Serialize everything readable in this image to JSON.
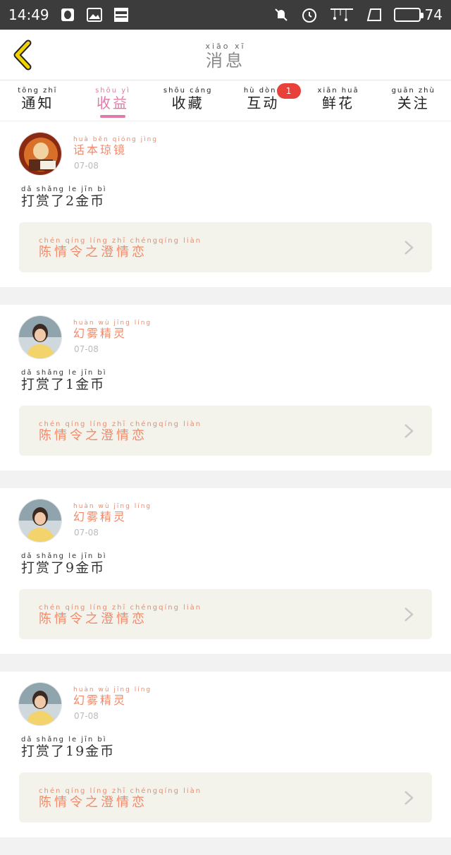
{
  "status_bar": {
    "time": "14:49",
    "battery": "74",
    "battery_level": 0.74
  },
  "header": {
    "title_pinyin": "xiāo xī",
    "title": "消息"
  },
  "tabs": [
    {
      "pinyin": "tōng zhī",
      "label": "通知"
    },
    {
      "pinyin": "shōu yì",
      "label": "收益"
    },
    {
      "pinyin": "shōu cáng",
      "label": "收藏"
    },
    {
      "pinyin": "hù dòng",
      "label": "互动",
      "badge": "1"
    },
    {
      "pinyin": "xiān huā",
      "label": "鲜花"
    },
    {
      "pinyin": "guān zhù",
      "label": "关注"
    }
  ],
  "active_tab": 1,
  "messages": [
    {
      "user_pinyin": "huà běn qióng jìng",
      "user": "话本琼镜",
      "date": "07-08",
      "tip_pinyin": "dǎ shǎng le  jīn bì",
      "tip": "打赏了2金币",
      "novel_pinyin": "chén qíng líng zhī chéngqíng liàn",
      "novel": "陈情令之澄情恋"
    },
    {
      "user_pinyin": "huàn wù jīng líng",
      "user": "幻雾精灵",
      "date": "07-08",
      "tip_pinyin": "dǎ shǎng le  jīn bì",
      "tip": "打赏了1金币",
      "novel_pinyin": "chén qíng líng zhī chéngqíng liàn",
      "novel": "陈情令之澄情恋"
    },
    {
      "user_pinyin": "huàn wù jīng líng",
      "user": "幻雾精灵",
      "date": "07-08",
      "tip_pinyin": "dǎ shǎng le  jīn bì",
      "tip": "打赏了9金币",
      "novel_pinyin": "chén qíng líng zhī chéngqíng liàn",
      "novel": "陈情令之澄情恋"
    },
    {
      "user_pinyin": "huàn wù jīng líng",
      "user": "幻雾精灵",
      "date": "07-08",
      "tip_pinyin": "dǎ shǎng le  jīn bì",
      "tip": "打赏了19金币",
      "novel_pinyin": "chén qíng líng zhī chéngqíng liàn",
      "novel": "陈情令之澄情恋"
    }
  ],
  "colors": {
    "accent": "#e07aa6",
    "name": "#f08a6a",
    "badge": "#e8403a",
    "back": "#f2d300"
  }
}
